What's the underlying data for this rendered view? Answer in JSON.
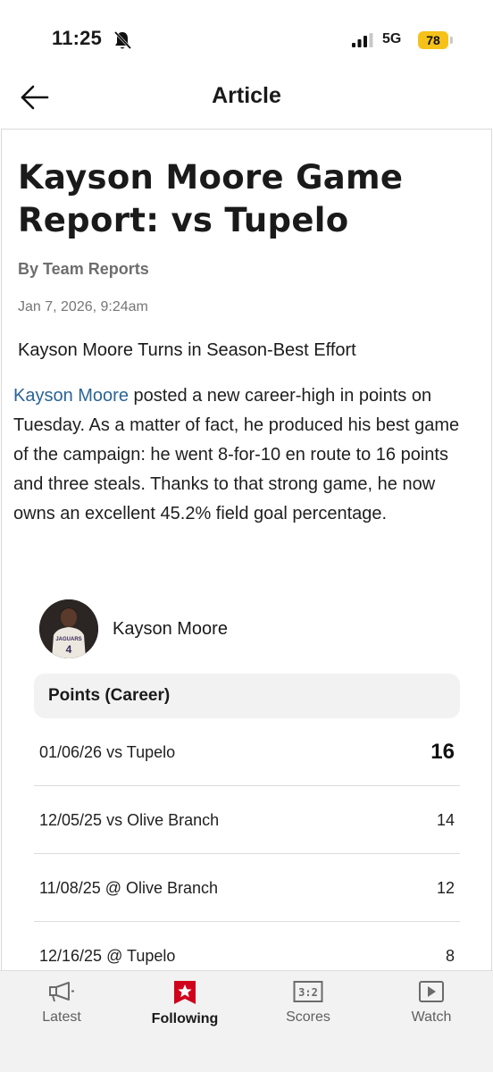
{
  "status_bar": {
    "time": "11:25",
    "network": "5G",
    "battery": "78"
  },
  "header": {
    "title": "Article"
  },
  "article": {
    "headline": "Kayson Moore Game Report: vs Tupelo",
    "byline": "By Team Reports",
    "date": "Jan 7, 2026, 9:24am",
    "subheadline": "Kayson Moore Turns in Season-Best Effort",
    "player_link": "Kayson Moore",
    "body": " posted a new career-high in points on Tuesday. As a matter of fact, he produced his best game of the campaign: he went 8-for-10 en route to 16 points and three steals. Thanks to that strong game, he now owns an excellent 45.2% field goal percentage."
  },
  "player_card": {
    "name": "Kayson Moore",
    "jersey_text": "JAGUARS",
    "jersey_number": "4",
    "stat_title": "Points (Career)",
    "rows": [
      {
        "game": "01/06/26 vs Tupelo",
        "value": "16"
      },
      {
        "game": "12/05/25 vs Olive Branch",
        "value": "14"
      },
      {
        "game": "11/08/25 @ Olive Branch",
        "value": "12"
      },
      {
        "game": "12/16/25 @ Tupelo",
        "value": "8"
      }
    ]
  },
  "tabs": [
    {
      "label": "Latest",
      "icon": "megaphone-icon"
    },
    {
      "label": "Following",
      "icon": "star-icon",
      "active": true
    },
    {
      "label": "Scores",
      "icon": "scoreboard-icon",
      "icon_text": "3:2"
    },
    {
      "label": "Watch",
      "icon": "play-icon"
    }
  ],
  "colors": {
    "accent_red": "#d0021b",
    "link_blue": "#2a6496",
    "battery_yellow": "#f6c21a"
  }
}
